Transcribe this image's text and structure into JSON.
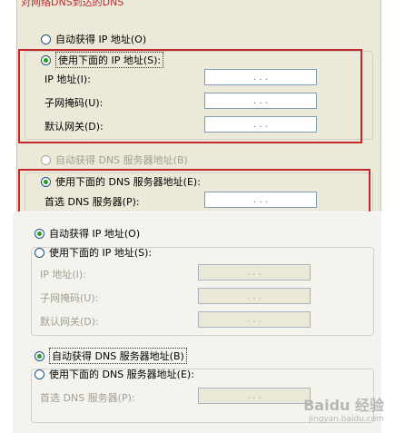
{
  "top_panel": {
    "cut_heading": "对网络DNS到达的DNS",
    "auto_ip_label": "自动获得 IP 地址(O)",
    "manual_ip_label": "使用下面的 IP 地址(S):",
    "fields": [
      {
        "label": "IP 地址(I):",
        "value": ". . ."
      },
      {
        "label": "子网掩码(U):",
        "value": ". . ."
      },
      {
        "label": "默认网关(D):",
        "value": ". . ."
      }
    ],
    "auto_dns_label": "自动获得 DNS 服务器地址(B)",
    "manual_dns_label": "使用下面的 DNS 服务器地址(E):",
    "preferred_dns_label": "首选 DNS 服务器(P):",
    "preferred_dns_value": ". . ."
  },
  "bottom_panel": {
    "auto_ip_label": "自动获得 IP 地址(O)",
    "manual_ip_label": "使用下面的 IP 地址(S):",
    "fields": [
      {
        "label": "IP 地址(I):",
        "value": ". . ."
      },
      {
        "label": "子网掩码(U):",
        "value": ". . ."
      },
      {
        "label": "默认网关(D):",
        "value": ". . ."
      }
    ],
    "auto_dns_label": "自动获得 DNS 服务器地址(B)",
    "manual_dns_label": "使用下面的 DNS 服务器地址(E):",
    "preferred_dns_label": "首选 DNS 服务器(P):",
    "preferred_dns_value": ". . ."
  },
  "watermark": {
    "brand": "Baidu 经验",
    "url": "jingyan.baidu.com"
  },
  "colors": {
    "highlight": "#c1272d",
    "radio_dot": "#21a121",
    "dialog_bg": "#ece9d8"
  }
}
